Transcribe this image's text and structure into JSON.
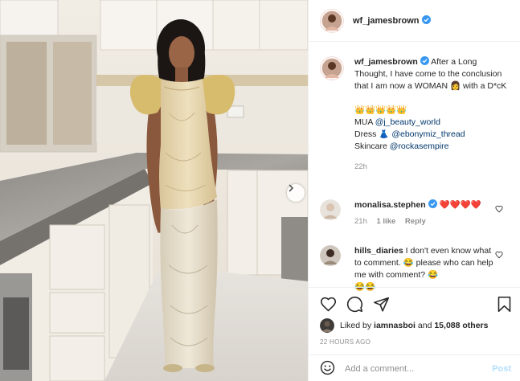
{
  "colors": {
    "link": "#00376b",
    "muted": "#8e8e8e",
    "verified": "#3897f0",
    "heart": "#ed4956",
    "post_disabled": "#b2dffc"
  },
  "post": {
    "author": "wf_jamesbrown",
    "photo": {
      "next_icon": "chevron-right-icon"
    }
  },
  "caption": {
    "username": "wf_jamesbrown",
    "line1": "After a Long Thought, I have come to the conclusion that I am now a WOMAN",
    "woman_emoji": "👩",
    "line1_end": "with a D*cK",
    "crowns": "👑👑👑👑👑",
    "mua_label": "MUA",
    "mua_handle": "@j_beauty_world",
    "dress_label": "Dress",
    "dress_emoji": "👗",
    "dress_handle": "@ebonymiz_thread",
    "skincare_label": "Skincare",
    "skincare_handle": "@rockasempire",
    "time": "22h"
  },
  "comments": [
    {
      "username": "monalisa.stephen",
      "verified": true,
      "text": "❤️❤️❤️❤️",
      "time": "21h",
      "likes": "1 like",
      "reply": "Reply"
    },
    {
      "username": "hills_diaries",
      "verified": false,
      "text": "I don't even know what to comment. 😂 please who can help me with comment? 😂",
      "trailing": "😂😂"
    }
  ],
  "actions": {
    "like_icon": "heart-icon",
    "comment_icon": "comment-icon",
    "share_icon": "share-icon",
    "save_icon": "bookmark-icon"
  },
  "likes": {
    "prefix": "Liked by",
    "user": "iamnasboi",
    "and": "and",
    "others": "15,088 others"
  },
  "posted": "22 HOURS AGO",
  "add_comment": {
    "placeholder": "Add a comment...",
    "post_label": "Post"
  }
}
